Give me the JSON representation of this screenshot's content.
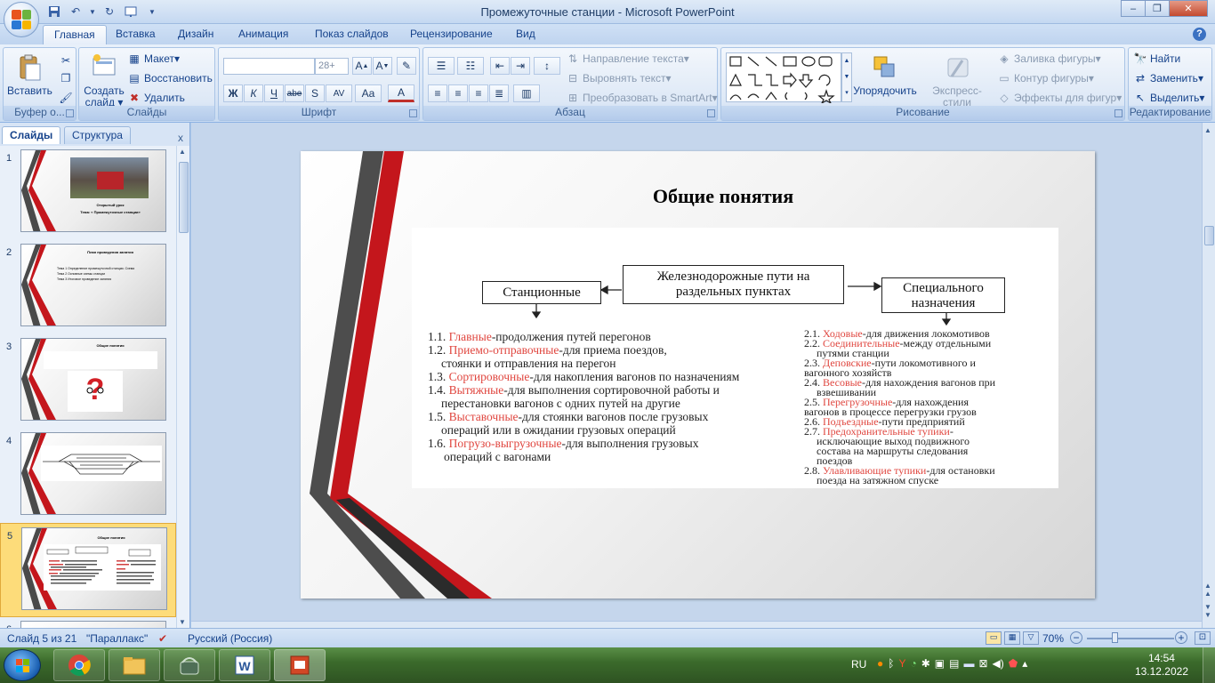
{
  "window": {
    "title": "Промежуточные станции - Microsoft PowerPoint",
    "minimize": "–",
    "maximize": "❐",
    "close": "✕"
  },
  "tabs": [
    "Главная",
    "Вставка",
    "Дизайн",
    "Анимация",
    "Показ слайдов",
    "Рецензирование",
    "Вид"
  ],
  "ribbon": {
    "clipboard": {
      "paste": "Вставить",
      "label": "Буфер о..."
    },
    "slides": {
      "new_slide": "Создать слайд",
      "layout": "Макет",
      "reset": "Восстановить",
      "delete": "Удалить",
      "label": "Слайды"
    },
    "font": {
      "font_name": "",
      "font_size": "28+",
      "label": "Шрифт",
      "bold": "Ж",
      "italic": "К",
      "underline": "Ч",
      "strike": "abe",
      "shadow": "S",
      "spacing": "AV",
      "case": "Aa",
      "color": "A"
    },
    "paragraph": {
      "text_direction": "Направление текста",
      "align_text": "Выровнять текст",
      "smartart": "Преобразовать в SmartArt",
      "label": "Абзац"
    },
    "drawing": {
      "arrange": "Упорядочить",
      "quick_styles": "Экспресс-стили",
      "fill": "Заливка фигуры",
      "outline": "Контур фигуры",
      "effects": "Эффекты для фигур",
      "label": "Рисование"
    },
    "editing": {
      "find": "Найти",
      "replace": "Заменить",
      "select": "Выделить",
      "label": "Редактирование"
    }
  },
  "pane": {
    "tab_slides": "Слайды",
    "tab_outline": "Структура",
    "close": "x",
    "thumbnails": [
      {
        "num": "1",
        "title": "Открытый урок",
        "subtitle": "Тема: « Промежуточные станции»"
      },
      {
        "num": "2",
        "title": "План проведения занятия",
        "lines": [
          "Тема 1 Определение промежуточной станции. Схема",
          "Тема 2 Основные схемы станции",
          "Тема 3 Итоговое проведение занятия"
        ]
      },
      {
        "num": "3",
        "title": "Общие понятия"
      },
      {
        "num": "4",
        "title": ""
      },
      {
        "num": "5",
        "title": "Общие понятия"
      },
      {
        "num": "6",
        "title": ""
      }
    ]
  },
  "slide": {
    "title": "Общие понятия",
    "diagram": {
      "center": "Железнодорожные пути на раздельных пунктах",
      "left": "Станционные",
      "right": "Специального назначения"
    },
    "left_list": [
      {
        "num": "1.1.",
        "term": "Главные",
        "rest": "-продолжения путей перегонов"
      },
      {
        "num": "1.2.",
        "term": "Приемо-отправочные",
        "rest": "-для приема поездов,"
      },
      {
        "num": "",
        "term": "",
        "rest": "стоянки и отправления на перегон"
      },
      {
        "num": "1.3.",
        "term": "Сортировочные",
        "rest": "-для накопления вагонов по назначениям"
      },
      {
        "num": "1.4.",
        "term": "Вытяжные",
        "rest": "-для выполнения сортировочной работы и"
      },
      {
        "num": "",
        "term": "",
        "rest": "перестановки вагонов с одних путей на другие"
      },
      {
        "num": "1.5.",
        "term": "Выставочные",
        "rest": "-для стоянки вагонов после грузовых"
      },
      {
        "num": "",
        "term": "",
        "rest": "операций или в ожидании грузовых операций"
      },
      {
        "num": "1.6.",
        "term": "Погрузо-выгрузочные",
        "rest": "-для выполнения грузовых"
      },
      {
        "num": "",
        "term": "",
        "rest": "операций с вагонами"
      }
    ],
    "right_list": [
      {
        "num": "2.1.",
        "term": "Ходовые",
        "rest": "-для движения локомотивов"
      },
      {
        "num": "2.2.",
        "term": "Соединительные",
        "rest": "-между отдельными"
      },
      {
        "num": "",
        "term": "",
        "rest": "путями станции"
      },
      {
        "num": "2.3.",
        "term": "Деповские",
        "rest": "-пути локомотивного и"
      },
      {
        "num": "",
        "term": "",
        "rest": "вагонного хозяйств"
      },
      {
        "num": "2.4.",
        "term": "Весовые",
        "rest": "-для нахождения вагонов при"
      },
      {
        "num": "",
        "term": "",
        "rest": "взвешивании"
      },
      {
        "num": "2.5.",
        "term": "Перегрузочные",
        "rest": "-для нахождения"
      },
      {
        "num": "",
        "term": "",
        "rest": "вагонов в процессе перегрузки грузов"
      },
      {
        "num": "2.6.",
        "term": "Подъездные",
        "rest": "-пути предприятий"
      },
      {
        "num": "2.7.",
        "term": "Предохранительные тупики",
        "rest": "-"
      },
      {
        "num": "",
        "term": "",
        "rest": "исключающие выход подвижного"
      },
      {
        "num": "",
        "term": "",
        "rest": "состава на маршруты следования"
      },
      {
        "num": "",
        "term": "",
        "rest": "поездов"
      },
      {
        "num": "2.8.",
        "term": "Улавливающие тупики",
        "rest": "-для остановки"
      },
      {
        "num": "",
        "term": "",
        "rest": "поезда на затяжном спуске"
      }
    ]
  },
  "status": {
    "slide_info": "Слайд 5 из 21",
    "theme": "\"Параллакс\"",
    "language": "Русский (Россия)",
    "zoom": "70%"
  },
  "taskbar": {
    "lang": "RU",
    "time": "14:54",
    "date": "13.12.2022"
  },
  "colors": {
    "accent_red": "#c4161c",
    "term_red": "#e0463f",
    "ribbon_text": "#15428b"
  }
}
